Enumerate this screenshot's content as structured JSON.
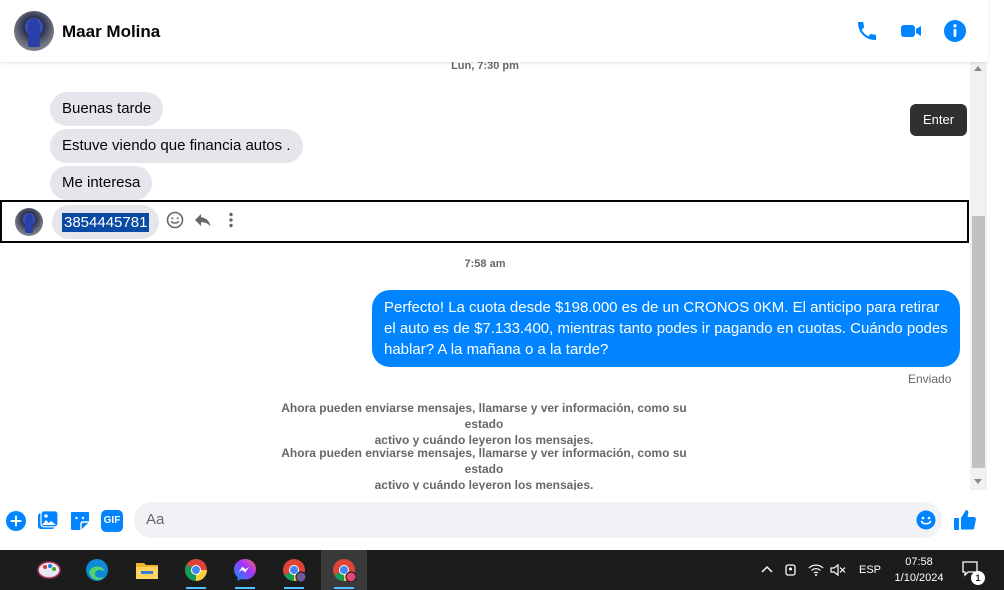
{
  "header": {
    "contact_name": "Maar Molina",
    "icons": [
      "phone-icon",
      "video-camera-icon",
      "info-icon"
    ],
    "accent_color": "#0084ff"
  },
  "chat": {
    "timestamp_1": "Lun, 7:30 pm",
    "incoming": [
      {
        "text": "Buenas tarde"
      },
      {
        "text": "Estuve viendo que financia autos ."
      },
      {
        "text": "Me interesa"
      }
    ],
    "selected_message": {
      "text": "3854445781",
      "tooltip": "Enter",
      "actions": [
        "emoji-react-icon",
        "reply-icon",
        "more-icon"
      ]
    },
    "timestamp_2": "7:58 am",
    "outgoing": {
      "text": "Perfecto! La cuota desde $198.000 es de un CRONOS 0KM. El anticipo para retirar el auto es de $7.133.400, mientras tanto podes ir pagando en cuotas. Cuándo podes hablar? A la mañana o a la tarde?",
      "status": "Enviado"
    },
    "system_messages": [
      {
        "line1": "Ahora pueden enviarse mensajes, llamarse y ver información, como su estado",
        "line2": "activo y cuándo leyeron los mensajes."
      },
      {
        "line1": "Ahora pueden enviarse mensajes, llamarse y ver información, como su estado",
        "line2": "activo y cuándo leyeron los mensajes."
      }
    ]
  },
  "composer": {
    "placeholder": "Aa",
    "icons": [
      "plus-icon",
      "image-icon",
      "sticker-icon",
      "gif-icon",
      "emoji-icon",
      "like-icon"
    ],
    "gif_label": "GIF"
  },
  "taskbar": {
    "apps": [
      "paint-icon",
      "edge-icon",
      "file-explorer-icon",
      "chrome-icon",
      "messenger-icon",
      "chrome-profile-icon",
      "chrome-profile-active-icon"
    ],
    "language": "ESP",
    "time": "07:58",
    "date": "1/10/2024",
    "notification_count": "1"
  }
}
